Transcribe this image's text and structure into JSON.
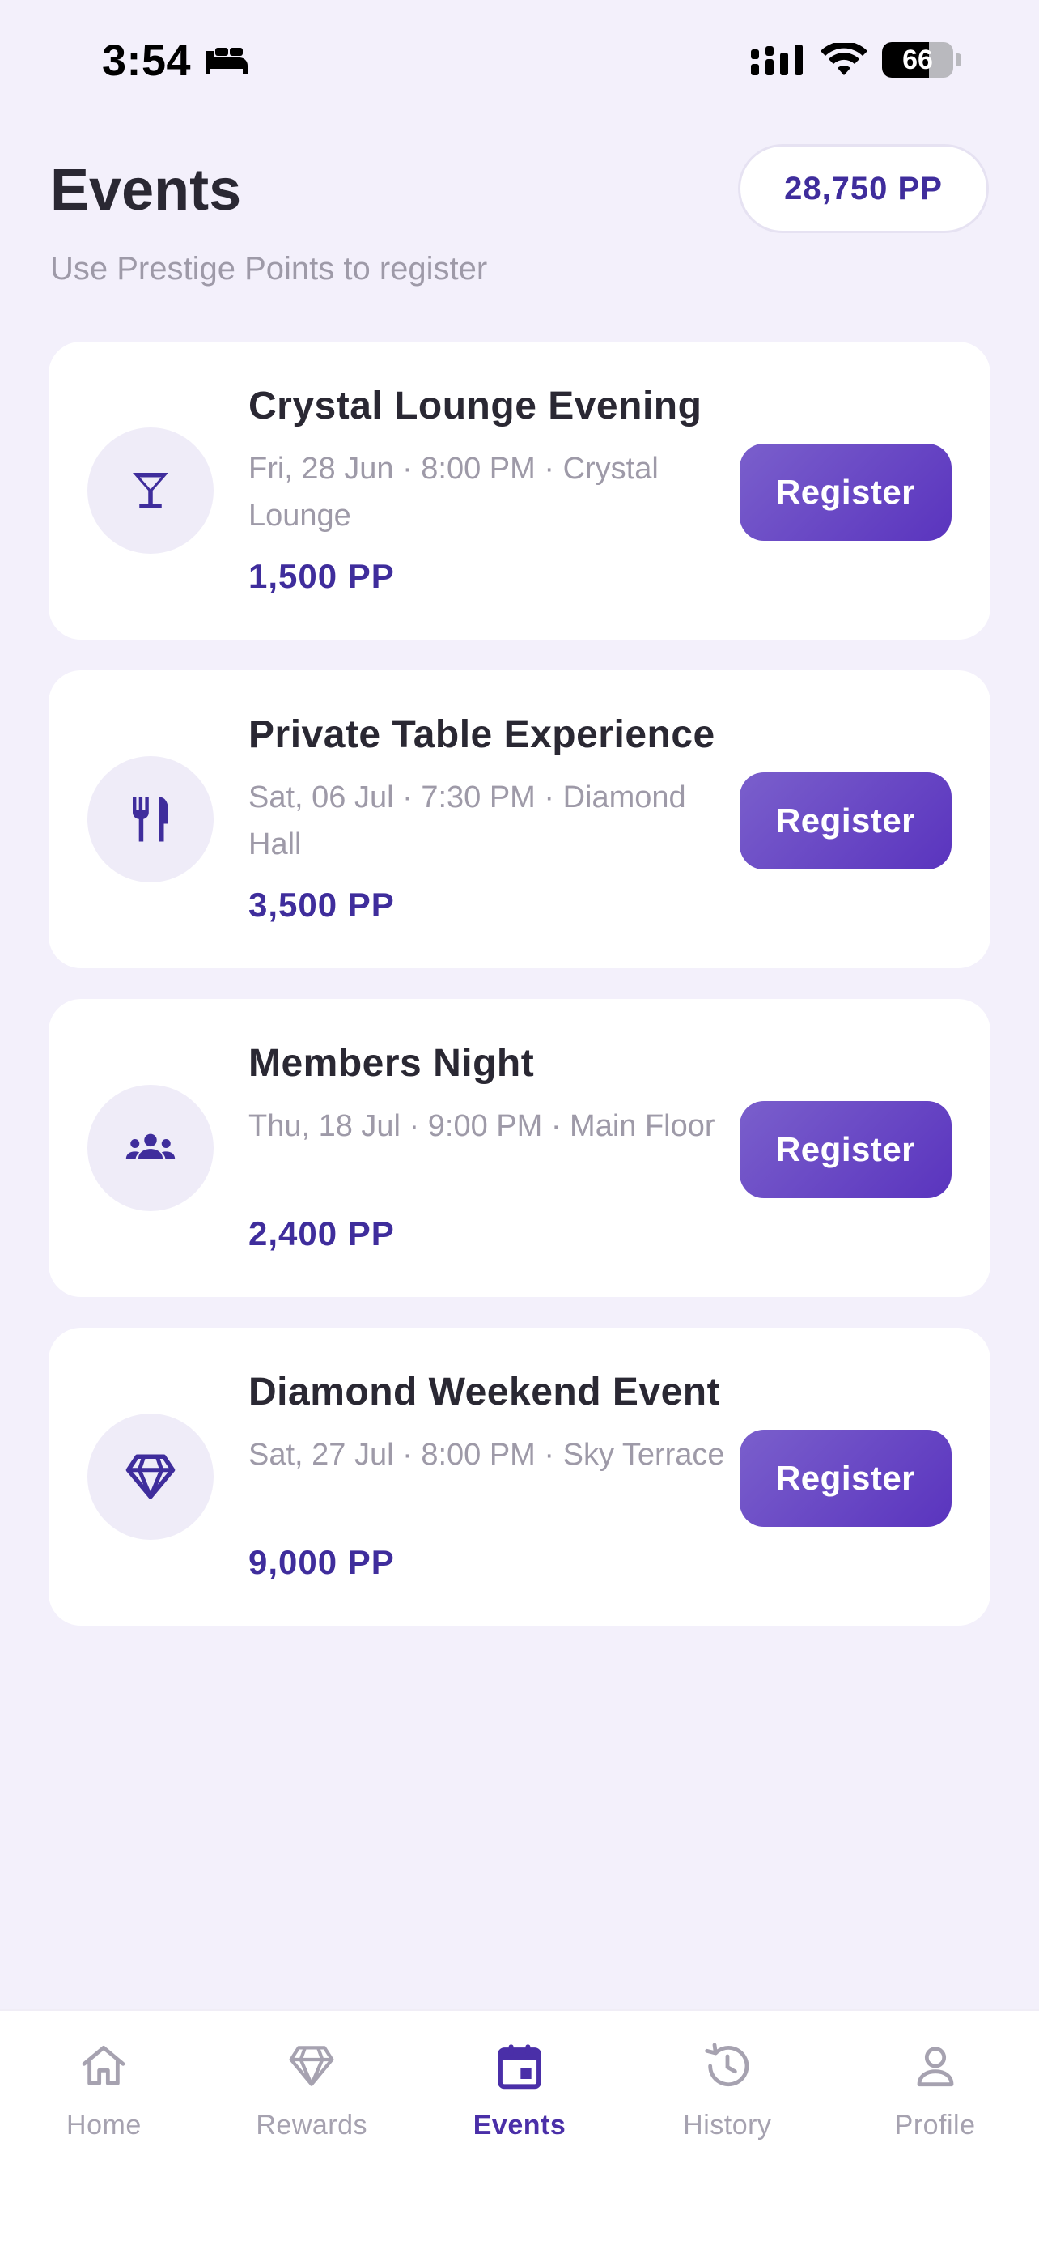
{
  "status_bar": {
    "time": "3:54",
    "battery": "66",
    "battery_level": 0.66,
    "icons": [
      "sleep-bed-icon",
      "cellular-signal-icon",
      "wifi-icon",
      "battery-icon"
    ]
  },
  "header": {
    "title": "Events",
    "subtitle": "Use Prestige Points to register",
    "points_balance": "28,750 PP"
  },
  "events": [
    {
      "title": "Crystal Lounge Evening",
      "meta": "Fri, 28 Jun · 8:00 PM · Crystal Lounge",
      "price": "1,500 PP",
      "icon": "cocktail-glass-icon",
      "button": "Register"
    },
    {
      "title": "Private Table Experience",
      "meta": "Sat, 06 Jul · 7:30 PM · Diamond Hall",
      "price": "3,500 PP",
      "icon": "fork-knife-icon",
      "button": "Register"
    },
    {
      "title": "Members Night",
      "meta": "Thu, 18 Jul · 9:00 PM · Main Floor",
      "price": "2,400 PP",
      "icon": "group-people-icon",
      "button": "Register"
    },
    {
      "title": "Diamond Weekend Event",
      "meta": "Sat, 27 Jul · 8:00 PM · Sky Terrace",
      "price": "9,000 PP",
      "icon": "diamond-icon",
      "button": "Register"
    }
  ],
  "tab_bar": {
    "active": "Events",
    "tabs": [
      {
        "label": "Home",
        "icon": "home-icon"
      },
      {
        "label": "Rewards",
        "icon": "diamond-icon"
      },
      {
        "label": "Events",
        "icon": "calendar-icon"
      },
      {
        "label": "History",
        "icon": "history-clock-icon"
      },
      {
        "label": "Profile",
        "icon": "person-icon"
      }
    ]
  },
  "colors": {
    "background": "#F3F0FB",
    "accent": "#3F2D9C",
    "button_gradient_start": "#7A5FCC",
    "button_gradient_end": "#5A34BE",
    "muted_text": "#9E9AA8",
    "icon_circle": "#EFECF8"
  }
}
